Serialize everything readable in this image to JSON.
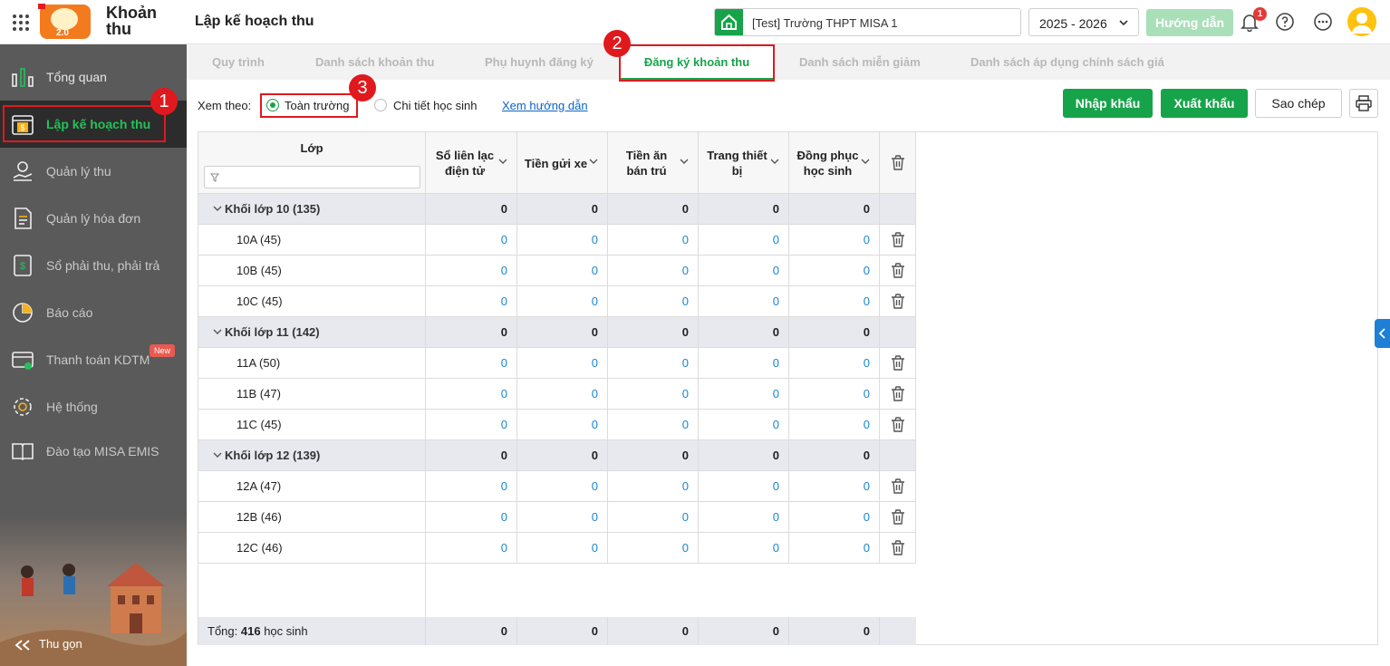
{
  "header": {
    "app_name": "Khoản thu",
    "logo_version": "2.0",
    "page_title": "Lập kế hoạch thu",
    "school": "[Test] Trường THPT MISA 1",
    "school_year": "2025 - 2026",
    "guide_button": "Hướng dẫn",
    "notification_count": "1"
  },
  "sidebar": {
    "items": [
      {
        "label": "Tổng quan",
        "icon": "bar-chart-icon"
      },
      {
        "label": "Lập kế hoạch thu",
        "icon": "calendar-dollar-icon"
      },
      {
        "label": "Quản lý thu",
        "icon": "hand-coin-icon"
      },
      {
        "label": "Quản lý hóa đơn",
        "icon": "invoice-icon"
      },
      {
        "label": "Sổ phải thu, phải trả",
        "icon": "ledger-icon"
      },
      {
        "label": "Báo cáo",
        "icon": "pie-chart-icon"
      },
      {
        "label": "Thanh toán KDTM",
        "icon": "card-payment-icon"
      },
      {
        "label": "Hệ thống",
        "icon": "gear-icon"
      },
      {
        "label": "Đào tạo MISA EMIS",
        "icon": "book-icon"
      }
    ],
    "new_badge": "New",
    "collapse_label": "Thu gọn"
  },
  "tabs": [
    {
      "label": "Quy trình"
    },
    {
      "label": "Danh sách khoản thu"
    },
    {
      "label": "Phụ huynh đăng ký"
    },
    {
      "label": "Đăng ký khoản thu"
    },
    {
      "label": "Danh sách miễn giảm"
    },
    {
      "label": "Danh sách áp dụng chính sách giá"
    }
  ],
  "steps": [
    "1",
    "2",
    "3"
  ],
  "toolbar": {
    "view_label": "Xem theo:",
    "option_school": "Toàn trường",
    "option_detail": "Chi tiết học sinh",
    "guide_link": "Xem hướng dẫn",
    "import": "Nhập khẩu",
    "export": "Xuất khẩu",
    "copy": "Sao chép"
  },
  "grid": {
    "col_class": "Lớp",
    "columns": [
      {
        "l1": "Sổ liên lạc",
        "l2": "điện tử"
      },
      {
        "l1": "Tiền gửi xe",
        "l2": ""
      },
      {
        "l1": "Tiền ăn",
        "l2": "bán trú"
      },
      {
        "l1": "Trang thiết",
        "l2": "bị"
      },
      {
        "l1": "Đồng phục",
        "l2": "học sinh"
      }
    ],
    "rows": [
      {
        "type": "group",
        "name": "Khối lớp 10 (135)",
        "values": [
          "0",
          "0",
          "0",
          "0",
          "0"
        ]
      },
      {
        "type": "class",
        "name": "10A (45)",
        "values": [
          "0",
          "0",
          "0",
          "0",
          "0"
        ]
      },
      {
        "type": "class",
        "name": "10B (45)",
        "values": [
          "0",
          "0",
          "0",
          "0",
          "0"
        ]
      },
      {
        "type": "class",
        "name": "10C (45)",
        "values": [
          "0",
          "0",
          "0",
          "0",
          "0"
        ]
      },
      {
        "type": "group",
        "name": "Khối lớp 11 (142)",
        "values": [
          "0",
          "0",
          "0",
          "0",
          "0"
        ]
      },
      {
        "type": "class",
        "name": "11A (50)",
        "values": [
          "0",
          "0",
          "0",
          "0",
          "0"
        ]
      },
      {
        "type": "class",
        "name": "11B (47)",
        "values": [
          "0",
          "0",
          "0",
          "0",
          "0"
        ]
      },
      {
        "type": "class",
        "name": "11C (45)",
        "values": [
          "0",
          "0",
          "0",
          "0",
          "0"
        ]
      },
      {
        "type": "group",
        "name": "Khối lớp 12 (139)",
        "values": [
          "0",
          "0",
          "0",
          "0",
          "0"
        ]
      },
      {
        "type": "class",
        "name": "12A (47)",
        "values": [
          "0",
          "0",
          "0",
          "0",
          "0"
        ]
      },
      {
        "type": "class",
        "name": "12B (46)",
        "values": [
          "0",
          "0",
          "0",
          "0",
          "0"
        ]
      },
      {
        "type": "class",
        "name": "12C (46)",
        "values": [
          "0",
          "0",
          "0",
          "0",
          "0"
        ]
      }
    ],
    "footer": {
      "prefix": "Tổng:",
      "count": "416",
      "suffix": "học sinh",
      "values": [
        "0",
        "0",
        "0",
        "0",
        "0"
      ]
    }
  },
  "colors": {
    "brand_green": "#17a34a",
    "sidebar_bg": "#5a5a5a",
    "highlight_red": "#e0191e",
    "link_blue": "#1a86d0"
  }
}
